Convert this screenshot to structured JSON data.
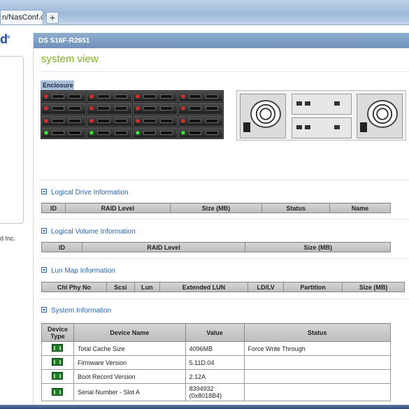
{
  "browser": {
    "tab_title": "n/NasConf.cgi",
    "new_tab": "+"
  },
  "sidebar": {
    "logo_fragment": "d",
    "copyright_fragment": "d Inc."
  },
  "main": {
    "header": "DS S16F-R2651",
    "title": "system view",
    "enclosure_tab": "Enclosure",
    "bay_leds": [
      "red",
      "red",
      "red",
      "red",
      "red",
      "red",
      "red",
      "red",
      "red",
      "red",
      "red",
      "red",
      "green",
      "green",
      "green",
      "green"
    ]
  },
  "logical_drive": {
    "heading": "Logical Drive Information",
    "columns": [
      "ID",
      "RAID Level",
      "Size (MB)",
      "Status",
      "Name"
    ]
  },
  "logical_volume": {
    "heading": "Logical Volume Information",
    "columns": [
      "ID",
      "RAID Level",
      "Size (MB)"
    ]
  },
  "lun_map": {
    "heading": "Lun Map Information",
    "columns": [
      "Chl Phy No",
      "Scsi",
      "Lun",
      "Extended LUN",
      "LD/LV",
      "Partition",
      "Size (MB)"
    ]
  },
  "system_info": {
    "heading": "System Information",
    "columns": [
      "Device Type",
      "Device Name",
      "Value",
      "Status"
    ],
    "rows": [
      {
        "name": "Total Cache Size",
        "value": "4096MB",
        "status": "Force Write Through"
      },
      {
        "name": "Firmware Version",
        "value": "5.11D.04",
        "status": ""
      },
      {
        "name": "Boot Record Version",
        "value": "2.12A",
        "status": ""
      },
      {
        "name": "Serial Number - Slot A",
        "value": "8394932 (0x8018B4)",
        "status": ""
      }
    ]
  },
  "colors": {
    "title_green": "#7ab31d",
    "link_blue": "#2864b4",
    "header_blue": "#6f91ba"
  }
}
